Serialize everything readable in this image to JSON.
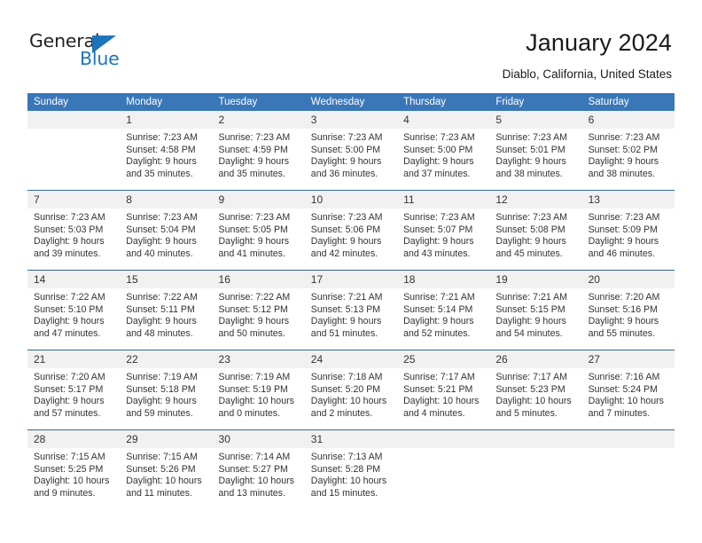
{
  "brand": {
    "name_top": "General",
    "name_bottom": "Blue",
    "accent_color": "#1c74bb",
    "triangle_icon": "triangle-icon"
  },
  "header": {
    "title": "January 2024",
    "subtitle": "Diablo, California, United States"
  },
  "theme": {
    "header_blue": "#3a77b8",
    "row_divider": "#33679f",
    "daynum_band": "#f1f1f1",
    "text": "#333333"
  },
  "calendar": {
    "month": "January",
    "year": "2024",
    "weekday_headers": [
      "Sunday",
      "Monday",
      "Tuesday",
      "Wednesday",
      "Thursday",
      "Friday",
      "Saturday"
    ],
    "weeks": [
      [
        {
          "day": "",
          "lines": []
        },
        {
          "day": "1",
          "lines": [
            "Sunrise: 7:23 AM",
            "Sunset: 4:58 PM",
            "Daylight: 9 hours",
            "and 35 minutes."
          ]
        },
        {
          "day": "2",
          "lines": [
            "Sunrise: 7:23 AM",
            "Sunset: 4:59 PM",
            "Daylight: 9 hours",
            "and 35 minutes."
          ]
        },
        {
          "day": "3",
          "lines": [
            "Sunrise: 7:23 AM",
            "Sunset: 5:00 PM",
            "Daylight: 9 hours",
            "and 36 minutes."
          ]
        },
        {
          "day": "4",
          "lines": [
            "Sunrise: 7:23 AM",
            "Sunset: 5:00 PM",
            "Daylight: 9 hours",
            "and 37 minutes."
          ]
        },
        {
          "day": "5",
          "lines": [
            "Sunrise: 7:23 AM",
            "Sunset: 5:01 PM",
            "Daylight: 9 hours",
            "and 38 minutes."
          ]
        },
        {
          "day": "6",
          "lines": [
            "Sunrise: 7:23 AM",
            "Sunset: 5:02 PM",
            "Daylight: 9 hours",
            "and 38 minutes."
          ]
        }
      ],
      [
        {
          "day": "7",
          "lines": [
            "Sunrise: 7:23 AM",
            "Sunset: 5:03 PM",
            "Daylight: 9 hours",
            "and 39 minutes."
          ]
        },
        {
          "day": "8",
          "lines": [
            "Sunrise: 7:23 AM",
            "Sunset: 5:04 PM",
            "Daylight: 9 hours",
            "and 40 minutes."
          ]
        },
        {
          "day": "9",
          "lines": [
            "Sunrise: 7:23 AM",
            "Sunset: 5:05 PM",
            "Daylight: 9 hours",
            "and 41 minutes."
          ]
        },
        {
          "day": "10",
          "lines": [
            "Sunrise: 7:23 AM",
            "Sunset: 5:06 PM",
            "Daylight: 9 hours",
            "and 42 minutes."
          ]
        },
        {
          "day": "11",
          "lines": [
            "Sunrise: 7:23 AM",
            "Sunset: 5:07 PM",
            "Daylight: 9 hours",
            "and 43 minutes."
          ]
        },
        {
          "day": "12",
          "lines": [
            "Sunrise: 7:23 AM",
            "Sunset: 5:08 PM",
            "Daylight: 9 hours",
            "and 45 minutes."
          ]
        },
        {
          "day": "13",
          "lines": [
            "Sunrise: 7:23 AM",
            "Sunset: 5:09 PM",
            "Daylight: 9 hours",
            "and 46 minutes."
          ]
        }
      ],
      [
        {
          "day": "14",
          "lines": [
            "Sunrise: 7:22 AM",
            "Sunset: 5:10 PM",
            "Daylight: 9 hours",
            "and 47 minutes."
          ]
        },
        {
          "day": "15",
          "lines": [
            "Sunrise: 7:22 AM",
            "Sunset: 5:11 PM",
            "Daylight: 9 hours",
            "and 48 minutes."
          ]
        },
        {
          "day": "16",
          "lines": [
            "Sunrise: 7:22 AM",
            "Sunset: 5:12 PM",
            "Daylight: 9 hours",
            "and 50 minutes."
          ]
        },
        {
          "day": "17",
          "lines": [
            "Sunrise: 7:21 AM",
            "Sunset: 5:13 PM",
            "Daylight: 9 hours",
            "and 51 minutes."
          ]
        },
        {
          "day": "18",
          "lines": [
            "Sunrise: 7:21 AM",
            "Sunset: 5:14 PM",
            "Daylight: 9 hours",
            "and 52 minutes."
          ]
        },
        {
          "day": "19",
          "lines": [
            "Sunrise: 7:21 AM",
            "Sunset: 5:15 PM",
            "Daylight: 9 hours",
            "and 54 minutes."
          ]
        },
        {
          "day": "20",
          "lines": [
            "Sunrise: 7:20 AM",
            "Sunset: 5:16 PM",
            "Daylight: 9 hours",
            "and 55 minutes."
          ]
        }
      ],
      [
        {
          "day": "21",
          "lines": [
            "Sunrise: 7:20 AM",
            "Sunset: 5:17 PM",
            "Daylight: 9 hours",
            "and 57 minutes."
          ]
        },
        {
          "day": "22",
          "lines": [
            "Sunrise: 7:19 AM",
            "Sunset: 5:18 PM",
            "Daylight: 9 hours",
            "and 59 minutes."
          ]
        },
        {
          "day": "23",
          "lines": [
            "Sunrise: 7:19 AM",
            "Sunset: 5:19 PM",
            "Daylight: 10 hours",
            "and 0 minutes."
          ]
        },
        {
          "day": "24",
          "lines": [
            "Sunrise: 7:18 AM",
            "Sunset: 5:20 PM",
            "Daylight: 10 hours",
            "and 2 minutes."
          ]
        },
        {
          "day": "25",
          "lines": [
            "Sunrise: 7:17 AM",
            "Sunset: 5:21 PM",
            "Daylight: 10 hours",
            "and 4 minutes."
          ]
        },
        {
          "day": "26",
          "lines": [
            "Sunrise: 7:17 AM",
            "Sunset: 5:23 PM",
            "Daylight: 10 hours",
            "and 5 minutes."
          ]
        },
        {
          "day": "27",
          "lines": [
            "Sunrise: 7:16 AM",
            "Sunset: 5:24 PM",
            "Daylight: 10 hours",
            "and 7 minutes."
          ]
        }
      ],
      [
        {
          "day": "28",
          "lines": [
            "Sunrise: 7:15 AM",
            "Sunset: 5:25 PM",
            "Daylight: 10 hours",
            "and 9 minutes."
          ]
        },
        {
          "day": "29",
          "lines": [
            "Sunrise: 7:15 AM",
            "Sunset: 5:26 PM",
            "Daylight: 10 hours",
            "and 11 minutes."
          ]
        },
        {
          "day": "30",
          "lines": [
            "Sunrise: 7:14 AM",
            "Sunset: 5:27 PM",
            "Daylight: 10 hours",
            "and 13 minutes."
          ]
        },
        {
          "day": "31",
          "lines": [
            "Sunrise: 7:13 AM",
            "Sunset: 5:28 PM",
            "Daylight: 10 hours",
            "and 15 minutes."
          ]
        },
        {
          "day": "",
          "lines": []
        },
        {
          "day": "",
          "lines": []
        },
        {
          "day": "",
          "lines": []
        }
      ]
    ]
  }
}
